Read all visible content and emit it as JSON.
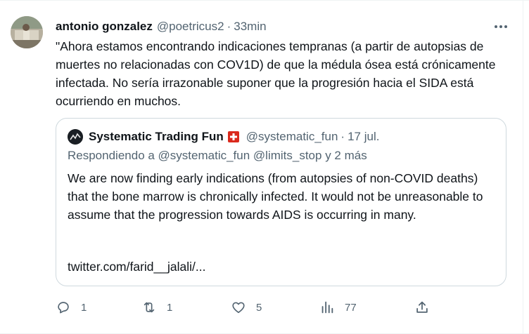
{
  "tweet": {
    "author_name": "antonio gonzalez",
    "author_handle": "@poetricus2",
    "separator": "·",
    "time": "33min",
    "text": "\"Ahora estamos encontrando indicaciones tempranas (a partir de autopsias de muertes no relacionadas con COV1D) de que la médula ósea está crónicamente infectada. No sería irrazonable suponer que la progresión hacia el SIDA está ocurriendo en muchos."
  },
  "quote": {
    "author_name": "Systematic Trading Fun",
    "author_handle": "@systematic_fun",
    "separator": "·",
    "time": "17 jul.",
    "reply_to": "Respondiendo a @systematic_fun @limits_stop y 2 más",
    "text": "We are now finding early indications (from autopsies of non-COVID deaths) that the bone marrow is chronically infected. It would not be unreasonable to assume that the progression towards AIDS is occurring in many.",
    "link": "twitter.com/farid__jalali/..."
  },
  "actions": {
    "replies": "1",
    "retweets": "1",
    "likes": "5",
    "views": "77"
  },
  "icons": {
    "more": "more-horizontal-icon",
    "reply": "reply-icon",
    "retweet": "retweet-icon",
    "like": "heart-icon",
    "views": "views-icon",
    "share": "share-icon",
    "flag": "swiss-flag-icon"
  },
  "colors": {
    "text": "#0f1419",
    "secondary": "#536471",
    "border": "#cfd9de",
    "flag_red": "#da291c"
  }
}
